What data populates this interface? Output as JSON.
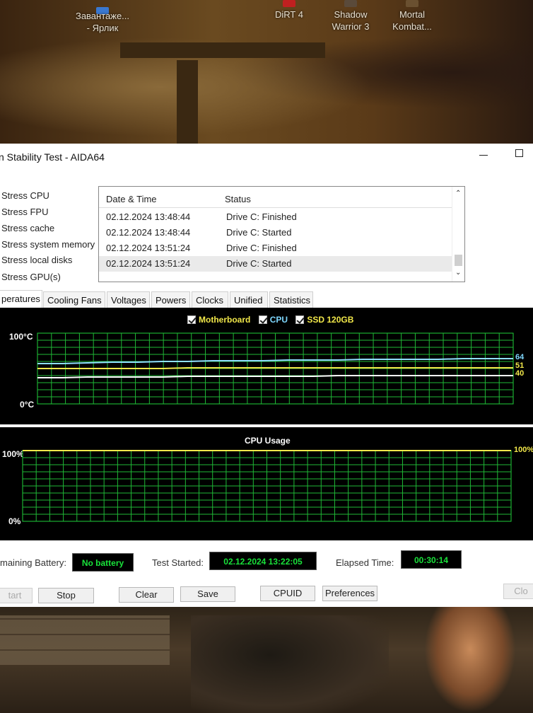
{
  "desktop": {
    "icons": [
      {
        "label": "Завантаже...\n- Ярлик"
      },
      {
        "label": "DiRT 4"
      },
      {
        "label": "Shadow\nWarrior 3"
      },
      {
        "label": "Mortal\nKombat..."
      }
    ]
  },
  "window": {
    "title": "n Stability Test - AIDA64"
  },
  "options": [
    "Stress CPU",
    "Stress FPU",
    "Stress cache",
    "Stress system memory",
    "Stress local disks",
    "Stress GPU(s)"
  ],
  "log": {
    "headers": [
      "Date & Time",
      "Status"
    ],
    "rows": [
      {
        "time": "02.12.2024 13:48:44",
        "status": "Drive C: Finished"
      },
      {
        "time": "02.12.2024 13:48:44",
        "status": "Drive C: Started"
      },
      {
        "time": "02.12.2024 13:51:24",
        "status": "Drive C: Finished"
      },
      {
        "time": "02.12.2024 13:51:24",
        "status": "Drive C: Started"
      }
    ]
  },
  "tabs": [
    "peratures",
    "Cooling Fans",
    "Voltages",
    "Powers",
    "Clocks",
    "Unified",
    "Statistics"
  ],
  "temp_graph": {
    "legend": [
      {
        "label": "Motherboard",
        "color": "#f2e84a"
      },
      {
        "label": "CPU",
        "color": "#7fd8ff"
      },
      {
        "label": "SSD 120GB",
        "color": "#f2e84a"
      }
    ],
    "y_top": "100°C",
    "y_bottom": "0°C",
    "end_values": [
      "64",
      "51",
      "40"
    ]
  },
  "cpu_graph": {
    "title": "CPU Usage",
    "y_top": "100%",
    "y_bottom": "0%",
    "end_value": "100%"
  },
  "chart_data": [
    {
      "type": "line",
      "title": "",
      "ylim": [
        0,
        100
      ],
      "grid": true,
      "series": [
        {
          "name": "CPU",
          "color": "#8fe0ff",
          "values": [
            57,
            57,
            58,
            59,
            59,
            60,
            60,
            61,
            61,
            61,
            62,
            62,
            62,
            63,
            63,
            63,
            63,
            64,
            64,
            64
          ]
        },
        {
          "name": "Motherboard",
          "color": "#f2e84a",
          "values": [
            50,
            50,
            50,
            50,
            50,
            50,
            51,
            51,
            51,
            51,
            51,
            51,
            51,
            51,
            51,
            51,
            51,
            51,
            51,
            51
          ]
        },
        {
          "name": "SSD 120GB",
          "color": "#ffffff",
          "values": [
            37,
            37,
            38,
            38,
            38,
            38,
            39,
            39,
            39,
            39,
            39,
            39,
            40,
            40,
            40,
            40,
            40,
            40,
            40,
            40
          ]
        }
      ]
    },
    {
      "type": "line",
      "title": "CPU Usage",
      "ylim": [
        0,
        100
      ],
      "grid": true,
      "series": [
        {
          "name": "",
          "color": "#f2e84a",
          "values": [
            100,
            100,
            100,
            100,
            100,
            100,
            100,
            100,
            100,
            100,
            100,
            100,
            100,
            100,
            100,
            100,
            100,
            100,
            100,
            100
          ]
        }
      ]
    }
  ],
  "status": {
    "battery_label": "maining Battery:",
    "battery_value": "No battery",
    "started_label": "Test Started:",
    "started_value": "02.12.2024 13:22:05",
    "elapsed_label": "Elapsed Time:",
    "elapsed_value": "00:30:14"
  },
  "buttons": {
    "start": "tart",
    "stop": "Stop",
    "clear": "Clear",
    "save": "Save",
    "cpuid": "CPUID",
    "preferences": "Preferences",
    "close": "Clo"
  }
}
